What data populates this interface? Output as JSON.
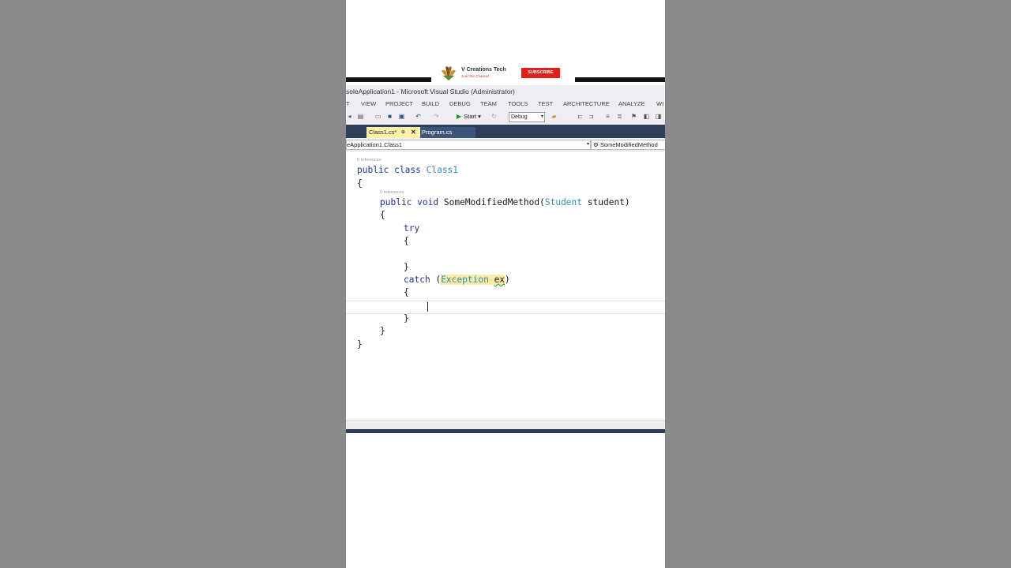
{
  "channel": {
    "name": "V Creations Tech",
    "tagline": "Join Our Channel",
    "subscribe_label": "SUBSCRIBE"
  },
  "window": {
    "title": "soleApplication1 - Microsoft Visual Studio (Administrator)"
  },
  "menu": {
    "items": [
      "T",
      "VIEW",
      "PROJECT",
      "BUILD",
      "DEBUG",
      "TEAM",
      "TOOLS",
      "TEST",
      "ARCHITECTURE",
      "ANALYZE",
      "WI"
    ]
  },
  "toolbar": {
    "start_label": "Start",
    "config_value": "Debug"
  },
  "tabs": [
    {
      "label": "Class1.cs*",
      "active": true
    },
    {
      "label": "Program.cs",
      "active": false
    }
  ],
  "navbar": {
    "left": "eApplication1.Class1",
    "right": "SomeModifiedMethod"
  },
  "code": {
    "refs_class": "0 references",
    "refs_method": "0 references",
    "l_public": "public",
    "l_class": "class",
    "l_classname": "Class1",
    "brace_open": "{",
    "brace_close": "}",
    "m_public": "public",
    "m_void": "void",
    "m_name": "SomeModifiedMethod(",
    "m_param_type": "Student",
    "m_param": "student)",
    "kw_try": "try",
    "kw_catch": "catch",
    "catch_open": "(",
    "ex_type": "Exception",
    "ex_name": "ex",
    "catch_close": ")"
  },
  "colors": {
    "keyword": "#1f2fa5",
    "type": "#2b91af",
    "tab_active_bg": "#fff1a8",
    "tabstrip_bg": "#2d3e5a",
    "subscribe_bg": "#e0201b"
  }
}
